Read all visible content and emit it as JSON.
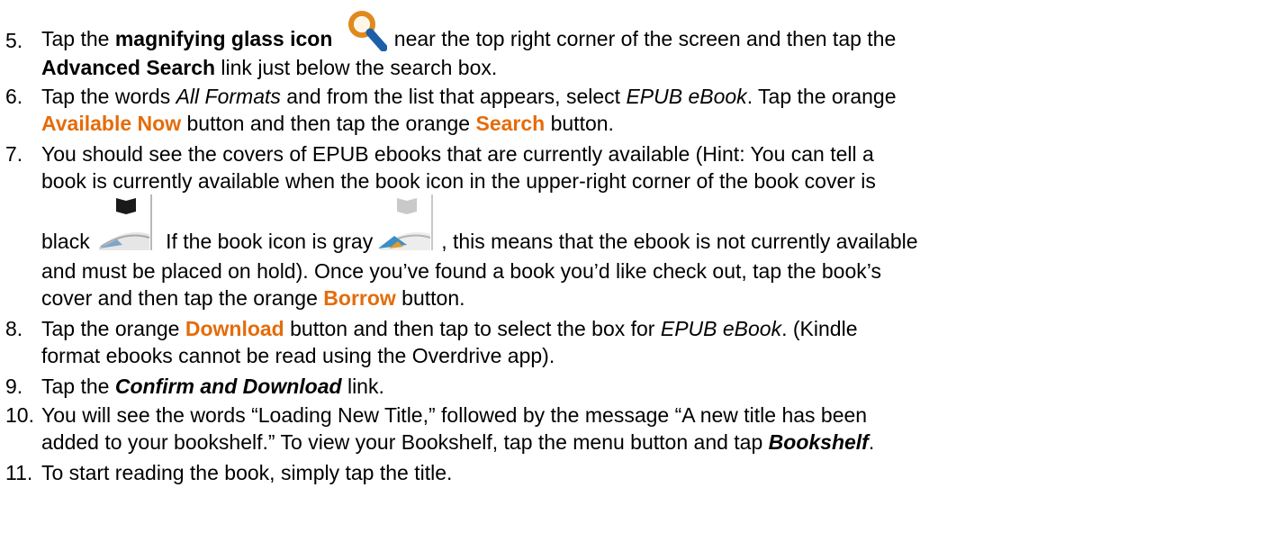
{
  "colors": {
    "accent_orange": "#E46C0A",
    "text": "#000000"
  },
  "icons": {
    "magnifier": "magnifying-glass-icon",
    "available_book": "book-black-icon",
    "unavailable_book": "book-gray-icon"
  },
  "steps": [
    {
      "number": "5.",
      "lines": [
        [
          "Tap the ",
          "magnifying glass icon",
          "near the top right corner of the screen and then tap the"
        ],
        [
          "Advanced Search",
          " link just below the search box."
        ]
      ]
    },
    {
      "number": "6.",
      "lines": [
        [
          "Tap the words ",
          "All Formats",
          " and from the list that appears, select ",
          "EPUB eBook",
          ".  Tap the orange"
        ],
        [
          "Available Now",
          " button and then tap the orange ",
          "Search",
          " button."
        ]
      ]
    },
    {
      "number": "7.",
      "lines": [
        [
          "You should see the covers of EPUB ebooks that are currently available (Hint: You can tell a"
        ],
        [
          "book is currently available when the book icon in the upper-right corner of the book cover is"
        ],
        [
          "black",
          " If the book icon is gray",
          ", this means that the ebook is not currently available"
        ],
        [
          "and must be placed on hold). Once you’ve found a book you’d like check out, tap the book’s"
        ],
        [
          "cover and then tap the orange ",
          "Borrow",
          " button."
        ]
      ]
    },
    {
      "number": "8.",
      "lines": [
        [
          "Tap the orange ",
          "Download",
          " button and then tap to select the box for ",
          "EPUB eBook",
          ".  (Kindle"
        ],
        [
          "format ebooks cannot be read using the Overdrive app)."
        ]
      ]
    },
    {
      "number": "9.",
      "lines": [
        [
          "Tap the ",
          "Confirm and Download",
          " link."
        ]
      ]
    },
    {
      "number": "10.",
      "lines": [
        [
          "You will see the words “Loading New Title,” followed by the message “A new title has been"
        ],
        [
          "added to your bookshelf.” To view your Bookshelf, tap the menu button and tap ",
          "Bookshelf",
          "."
        ]
      ]
    },
    {
      "number": "11.",
      "lines": [
        [
          "To start reading the book, simply tap the title."
        ]
      ]
    }
  ]
}
